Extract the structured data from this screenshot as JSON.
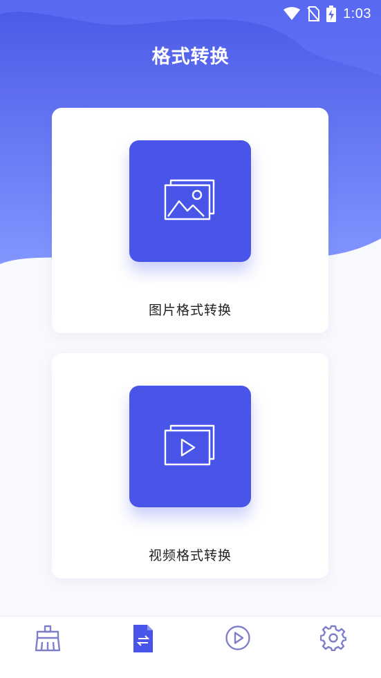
{
  "status_bar": {
    "time": "1:03",
    "icons": [
      "wifi-icon",
      "no-sim-icon",
      "battery-charging-icon"
    ]
  },
  "header": {
    "title": "格式转换"
  },
  "cards": [
    {
      "label": "图片格式转换",
      "icon": "image-stack-icon"
    },
    {
      "label": "视频格式转换",
      "icon": "video-stack-icon"
    }
  ],
  "bottom_nav": {
    "items": [
      {
        "icon": "clean-brush-icon",
        "active": false
      },
      {
        "icon": "convert-file-icon",
        "active": true
      },
      {
        "icon": "play-circle-icon",
        "active": false
      },
      {
        "icon": "gear-icon",
        "active": false
      }
    ]
  },
  "colors": {
    "accent": "#4855e8",
    "header_top": "#4d5be6",
    "header_bottom": "#7f93ff",
    "nav_inactive": "#7e7fc8"
  }
}
